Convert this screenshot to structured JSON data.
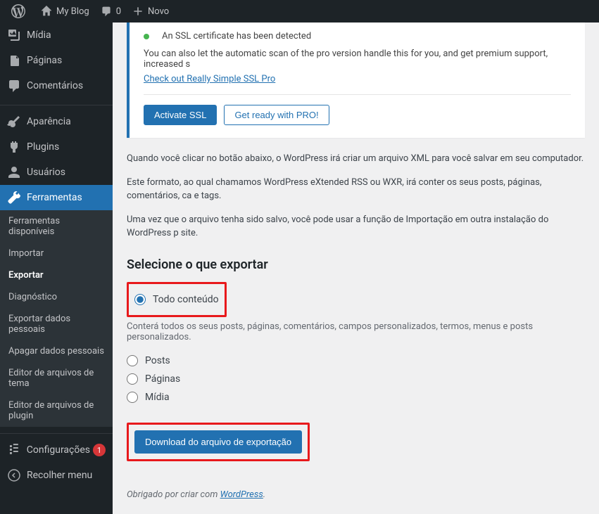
{
  "adminBar": {
    "siteTitle": "My Blog",
    "commentCount": "0",
    "newLabel": "Novo"
  },
  "sidebar": {
    "media": "Mídia",
    "pages": "Páginas",
    "comments": "Comentários",
    "appearance": "Aparência",
    "plugins": "Plugins",
    "users": "Usuários",
    "tools": "Ferramentas",
    "settings": "Configurações",
    "settingsBadge": "1",
    "collapse": "Recolher menu"
  },
  "toolsSubmenu": {
    "available": "Ferramentas disponíveis",
    "import": "Importar",
    "export": "Exportar",
    "diagnostic": "Diagnóstico",
    "exportPersonal": "Exportar dados pessoais",
    "erasePersonal": "Apagar dados pessoais",
    "themeEditor": "Editor de arquivos de tema",
    "pluginEditor": "Editor de arquivos de plugin"
  },
  "notice": {
    "sslDetected": "An SSL certificate has been detected",
    "proText": "You can also let the automatic scan of the pro version handle this for you, and get premium support, increased s",
    "proLink": "Check out Really Simple SSL Pro",
    "activateBtn": "Activate SSL",
    "proBtn": "Get ready with PRO!"
  },
  "exportPage": {
    "p1": "Quando você clicar no botão abaixo, o WordPress irá criar um arquivo XML para você salvar em seu computador.",
    "p2": "Este formato, ao qual chamamos WordPress eXtended RSS ou WXR, irá conter os seus posts, páginas, comentários, ca e tags.",
    "p3": "Uma vez que o arquivo tenha sido salvo, você pode usar a função de Importação em outra instalação do WordPress p site.",
    "heading": "Selecione o que exportar",
    "optAll": "Todo conteúdo",
    "optAllHelp": "Conterá todos os seus posts, páginas, comentários, campos personalizados, termos, menus e posts personalizados.",
    "optPosts": "Posts",
    "optPages": "Páginas",
    "optMedia": "Mídia",
    "downloadBtn": "Download do arquivo de exportação"
  },
  "footer": {
    "thanksPrefix": "Obrigado por criar com ",
    "wpLink": "WordPress",
    "period": "."
  }
}
